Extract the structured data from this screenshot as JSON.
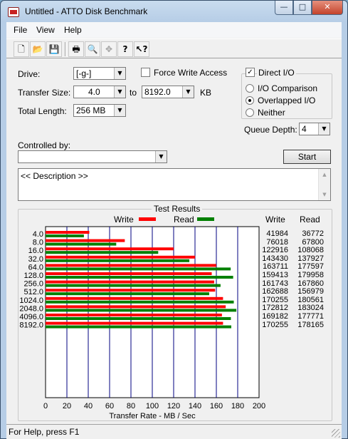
{
  "window": {
    "title": "Untitled - ATTO Disk Benchmark"
  },
  "menu": [
    "File",
    "View",
    "Help"
  ],
  "toolbar": {
    "buttons": [
      "new-icon",
      "open-icon",
      "save-icon",
      "print-icon",
      "print-preview-icon",
      "move-icon",
      "help-icon",
      "context-help-icon"
    ]
  },
  "form": {
    "drive_label": "Drive:",
    "drive_value": "[-g-]",
    "force_write_label": "Force Write Access",
    "force_write_checked": false,
    "direct_io_label": "Direct I/O",
    "direct_io_checked": true,
    "transfer_size_label": "Transfer Size:",
    "transfer_from": "4.0",
    "transfer_to_word": "to",
    "transfer_to": "8192.0",
    "transfer_unit": "KB",
    "total_length_label": "Total Length:",
    "total_length_value": "256 MB",
    "io_comparison_label": "I/O Comparison",
    "overlapped_io_label": "Overlapped I/O",
    "neither_label": "Neither",
    "selected_mode": "Overlapped I/O",
    "queue_depth_label": "Queue Depth:",
    "queue_depth_value": "4",
    "controlled_by_label": "Controlled by:",
    "controlled_by_value": "",
    "start_label": "Start",
    "description_text": "<< Description >>"
  },
  "results": {
    "group_title": "Test Results",
    "legend_write": "Write",
    "legend_read": "Read",
    "col_write": "Write",
    "col_read": "Read",
    "write_color": "#ff0000",
    "read_color": "#008000"
  },
  "chart_data": {
    "type": "bar",
    "orientation": "horizontal",
    "categories": [
      "4.0",
      "8.0",
      "16.0",
      "32.0",
      "64.0",
      "128.0",
      "256.0",
      "512.0",
      "1024.0",
      "2048.0",
      "4096.0",
      "8192.0"
    ],
    "series": [
      {
        "name": "Write",
        "values": [
          41984,
          76018,
          122916,
          143430,
          163711,
          159413,
          161743,
          162688,
          170255,
          172812,
          169182,
          170255
        ]
      },
      {
        "name": "Read",
        "values": [
          36772,
          67800,
          108068,
          137927,
          177597,
          179958,
          167860,
          156979,
          180561,
          183024,
          177771,
          178165
        ]
      }
    ],
    "xlabel": "Transfer Rate - MB / Sec",
    "xticks": [
      0,
      20,
      40,
      60,
      80,
      100,
      120,
      140,
      160,
      180,
      200
    ],
    "xlim": [
      0,
      200
    ],
    "grid": true,
    "legend": "top"
  },
  "status": {
    "text": "For Help, press F1"
  }
}
